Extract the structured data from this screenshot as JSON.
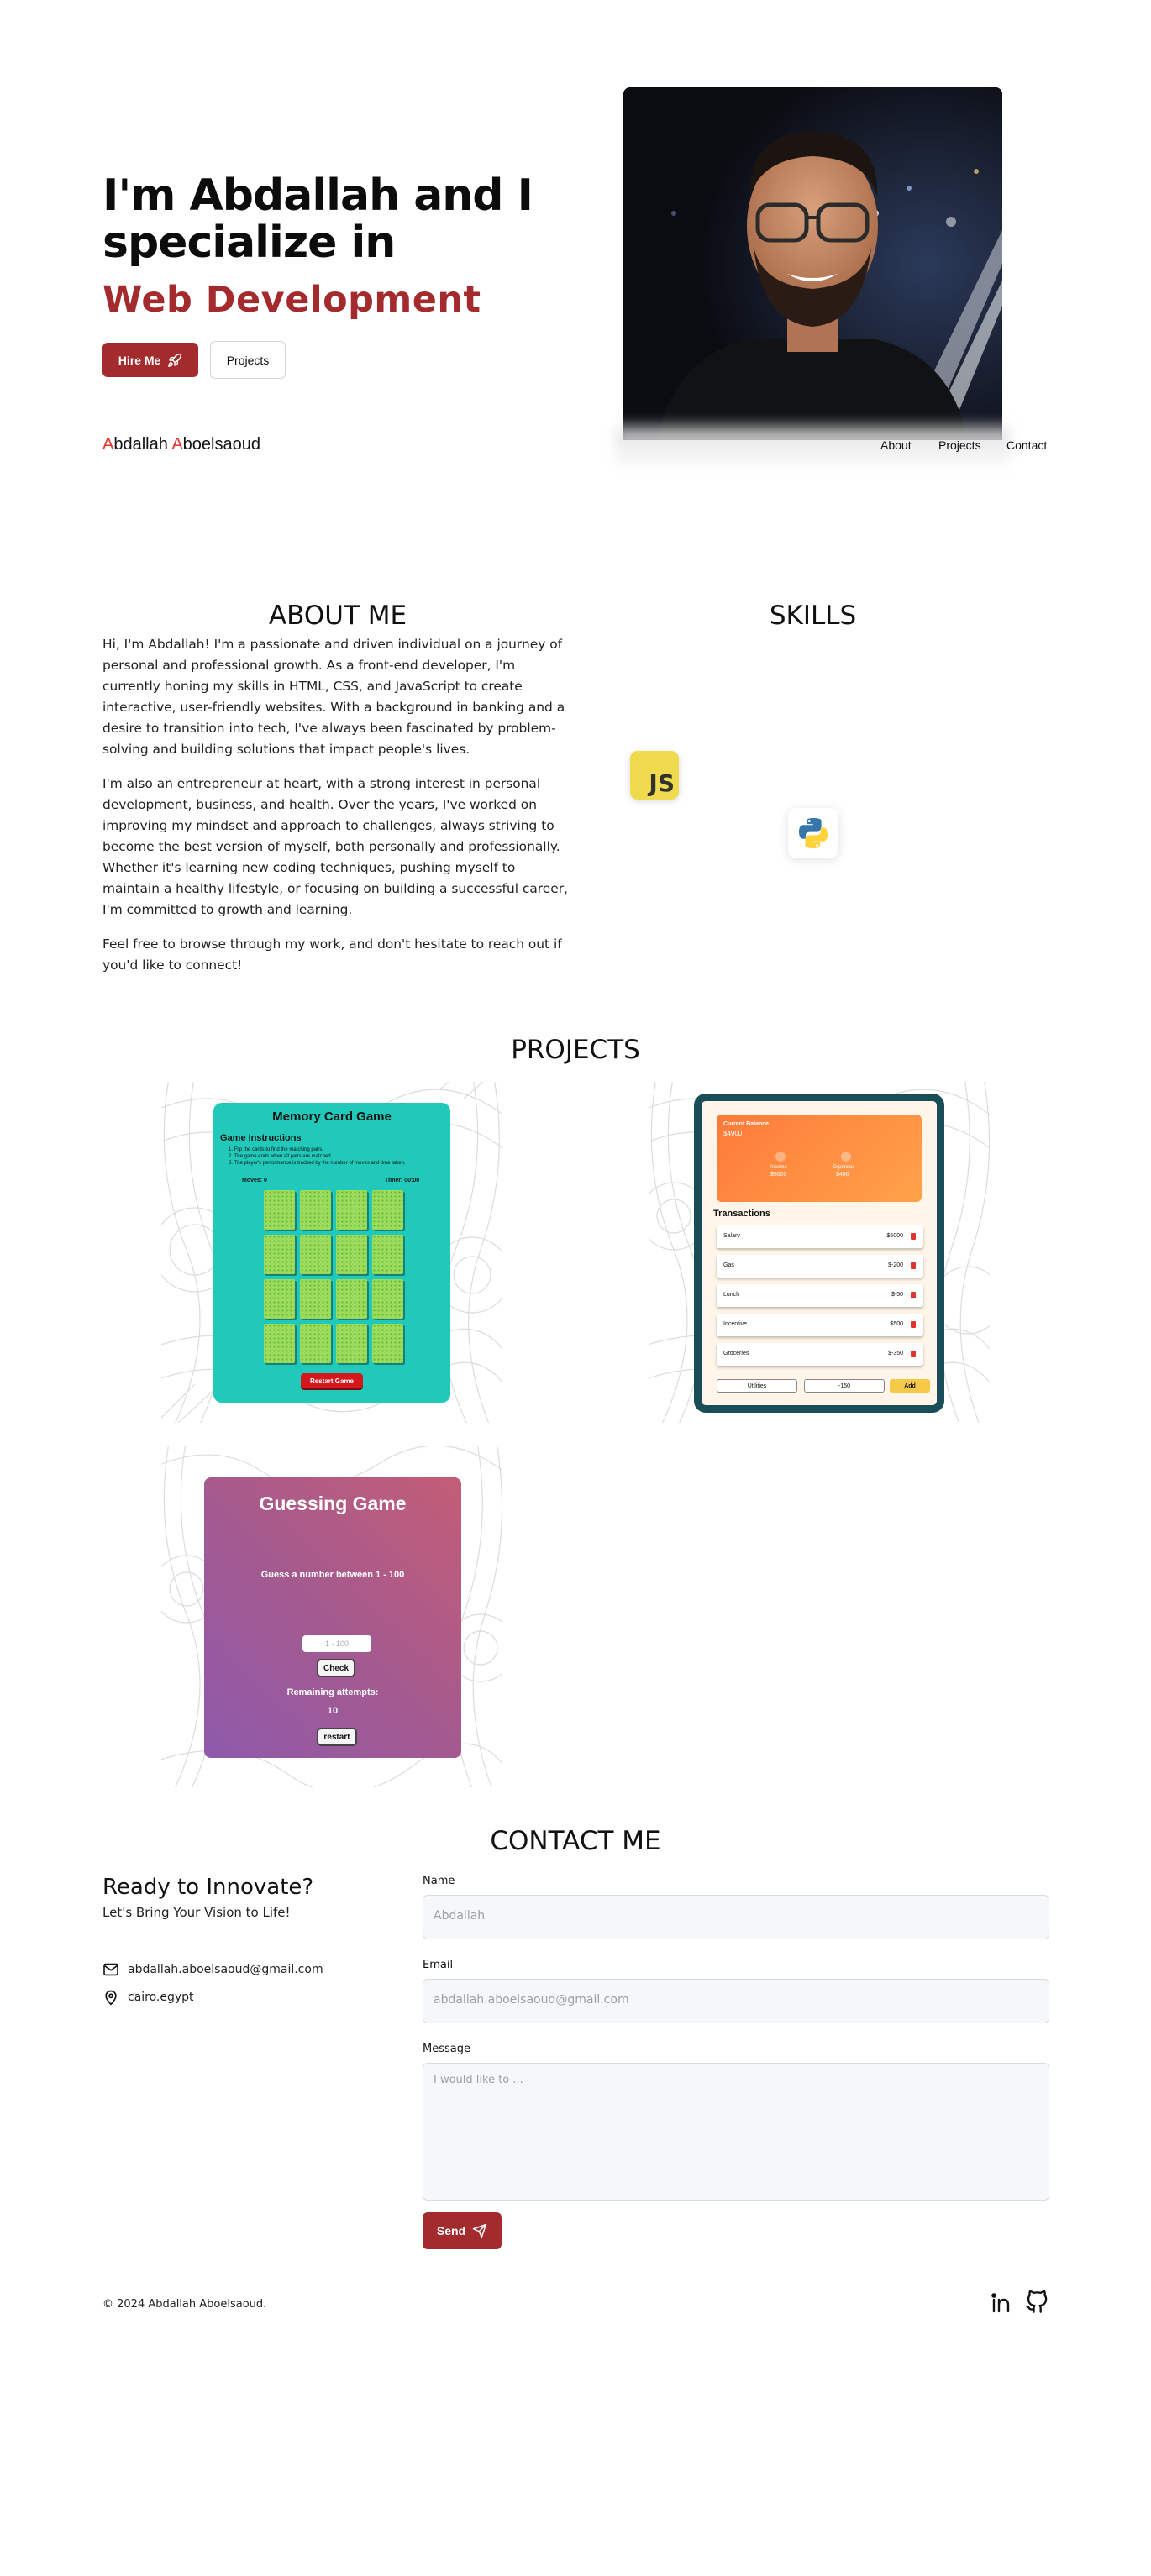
{
  "hero": {
    "title": "I'm Abdallah and I specialize in",
    "accent": "Web Development",
    "hire_label": "Hire Me",
    "projects_label": "Projects"
  },
  "nav": {
    "logo_first_initial": "A",
    "logo_first_rest": "bdallah ",
    "logo_last_initial": "A",
    "logo_last_rest": "boelsaoud",
    "items": [
      "About",
      "Projects",
      "Contact"
    ]
  },
  "about": {
    "title": "ABOUT ME",
    "paragraphs": [
      "Hi, I'm Abdallah! I'm a passionate and driven individual on a journey of personal and professional growth. As a front-end developer, I'm currently honing my skills in HTML, CSS, and JavaScript to create interactive, user-friendly websites. With a background in banking and a desire to transition into tech, I've always been fascinated by problem-solving and building solutions that impact people's lives.",
      "I'm also an entrepreneur at heart, with a strong interest in personal development, business, and health. Over the years, I've worked on improving my mindset and approach to challenges, always striving to become the best version of myself, both personally and professionally. Whether it's learning new coding techniques, pushing myself to maintain a healthy lifestyle, or focusing on building a successful career, I'm committed to growth and learning.",
      "Feel free to browse through my work, and don't hesitate to reach out if you'd like to connect!"
    ]
  },
  "skills": {
    "title": "SKILLS",
    "js_label": "JS",
    "icons": [
      "javascript-icon",
      "python-icon"
    ]
  },
  "projects": {
    "title": "PROJECTS",
    "memory": {
      "title": "Memory Card Game",
      "instructions_title": "Game Instructions",
      "instructions": [
        "1. Flip the cards to find the matching pairs.",
        "2. The game ends when all pairs are matched.",
        "3. The player's performance is tracked by the number of moves and time taken."
      ],
      "moves": "Moves: 0",
      "timer": "Timer: 00:00",
      "restart": "Restart Game"
    },
    "finance": {
      "balance_label": "Current Balance",
      "balance": "$4900",
      "income_label": "Income",
      "income": "$5000",
      "expenses_label": "Expenses",
      "expenses": "$400",
      "transactions_title": "Transactions",
      "transactions": [
        {
          "name": "Salary",
          "amount": "$5000"
        },
        {
          "name": "Gas",
          "amount": "$-200"
        },
        {
          "name": "Lunch",
          "amount": "$-50"
        },
        {
          "name": "Incentive",
          "amount": "$500"
        },
        {
          "name": "Groceries",
          "amount": "$-350"
        }
      ],
      "input_name": "Utilities",
      "input_amount": "-150",
      "add": "Add"
    },
    "guessing": {
      "title": "Guessing Game",
      "prompt": "Guess a number between 1 - 100",
      "placeholder": "1 - 100",
      "check": "Check",
      "remaining_label": "Remaining attempts:",
      "remaining": "10",
      "restart": "restart"
    }
  },
  "contact": {
    "title": "CONTACT ME",
    "heading": "Ready to Innovate?",
    "subheading": "Let's Bring Your Vision to Life!",
    "email": "abdallah.aboelsaoud@gmail.com",
    "location": "cairo.egypt",
    "name_label": "Name",
    "name_placeholder": "Abdallah",
    "email_label": "Email",
    "email_placeholder": "abdallah.aboelsaoud@gmail.com",
    "message_label": "Message",
    "message_placeholder": "I would like to ...",
    "send": "Send"
  },
  "footer": {
    "copyright": "© 2024 Abdallah Aboelsaoud."
  },
  "colors": {
    "brand_red": "#a32a2d",
    "logo_red": "#e0342f",
    "memory_teal": "#20c9b9",
    "finance_dark": "#194e58",
    "finance_orange": "#ff8a3d",
    "add_yellow": "#f7c948"
  }
}
